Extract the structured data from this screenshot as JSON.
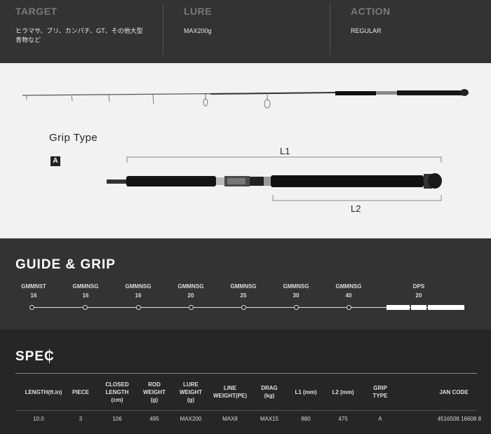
{
  "info": {
    "target": {
      "title": "TARGET",
      "value": "ヒラマサ、ブリ、カンパチ、GT、その他大型青物など"
    },
    "lure": {
      "title": "LURE",
      "value": "MAX200g"
    },
    "action": {
      "title": "ACTION",
      "value": "REGULAR"
    }
  },
  "grip_type": {
    "title": "Grip Type",
    "badge": "A",
    "l1_label": "L1",
    "l2_label": "L2"
  },
  "guide_grip": {
    "title": "GUIDE & GRIP",
    "guides": [
      {
        "name": "GMMNST",
        "size": "16"
      },
      {
        "name": "GMMNSG",
        "size": "16"
      },
      {
        "name": "GMMNSG",
        "size": "16"
      },
      {
        "name": "GMMNSG",
        "size": "20"
      },
      {
        "name": "GMMNSG",
        "size": "25"
      },
      {
        "name": "GMMNSG",
        "size": "30"
      },
      {
        "name": "GMMNSG",
        "size": "40"
      }
    ],
    "reel_seat": {
      "name": "DPS",
      "size": "20"
    }
  },
  "spec": {
    "title": "SPEC",
    "headers": [
      "LENGTH(ft.in)",
      "PIECE",
      "CLOSED\nLENGTH\n(cm)",
      "ROD\nWEIGHT\n(g)",
      "LURE\nWEIGHT\n(g)",
      "LINE\nWEIGHT(PE)",
      "DRAG\n(kg)",
      "L1 (mm)",
      "L2 (mm)",
      "GRIP\nTYPE",
      "JAN CODE"
    ],
    "row": [
      "10.0",
      "3",
      "106",
      "495",
      "MAX200",
      "MAX8",
      "MAX15",
      "880",
      "475",
      "A",
      "4516508 16608 8"
    ]
  }
}
